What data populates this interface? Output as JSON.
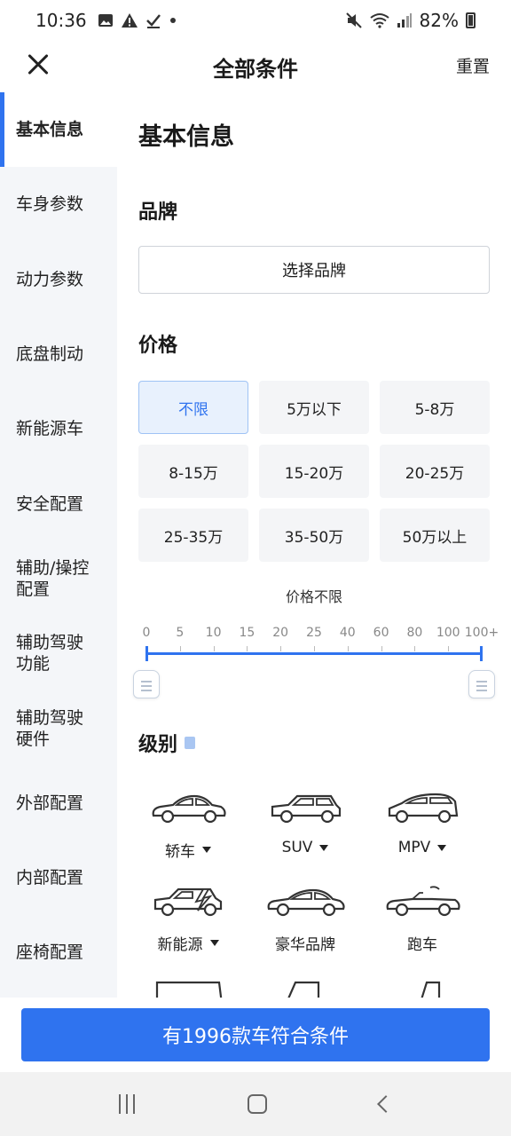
{
  "status_bar": {
    "time": "10:36",
    "battery": "82%"
  },
  "header": {
    "title": "全部条件",
    "reset": "重置"
  },
  "sidebar": {
    "items": [
      {
        "label": "基本信息",
        "active": true
      },
      {
        "label": "车身参数"
      },
      {
        "label": "动力参数"
      },
      {
        "label": "底盘制动"
      },
      {
        "label": "新能源车"
      },
      {
        "label": "安全配置"
      },
      {
        "label": "辅助/操控配置"
      },
      {
        "label": "辅助驾驶功能"
      },
      {
        "label": "辅助驾驶硬件"
      },
      {
        "label": "外部配置"
      },
      {
        "label": "内部配置"
      },
      {
        "label": "座椅配置"
      }
    ]
  },
  "main": {
    "section_title": "基本信息",
    "brand": {
      "title": "品牌",
      "button": "选择品牌"
    },
    "price": {
      "title": "价格",
      "options": [
        "不限",
        "5万以下",
        "5-8万",
        "8-15万",
        "15-20万",
        "20-25万",
        "25-35万",
        "35-50万",
        "50万以上"
      ],
      "selected_index": 0,
      "range_caption": "价格不限",
      "ticks": [
        "0",
        "5",
        "10",
        "15",
        "20",
        "25",
        "40",
        "60",
        "80",
        "100",
        "100+"
      ]
    },
    "level": {
      "title": "级别",
      "items": [
        {
          "label": "轿车",
          "icon": "sedan-icon",
          "dropdown": true
        },
        {
          "label": "SUV",
          "icon": "suv-icon",
          "dropdown": true
        },
        {
          "label": "MPV",
          "icon": "mpv-icon",
          "dropdown": true
        },
        {
          "label": "新能源",
          "icon": "ev-car-icon",
          "dropdown": true
        },
        {
          "label": "豪华品牌",
          "icon": "luxury-car-icon",
          "dropdown": false
        },
        {
          "label": "跑车",
          "icon": "sports-car-icon",
          "dropdown": false
        }
      ]
    }
  },
  "footer": {
    "cta": "有1996款车符合条件"
  },
  "colors": {
    "accent": "#2f73ef",
    "sidebar_bg": "#f4f6f9",
    "chip_bg": "#f4f5f7"
  }
}
